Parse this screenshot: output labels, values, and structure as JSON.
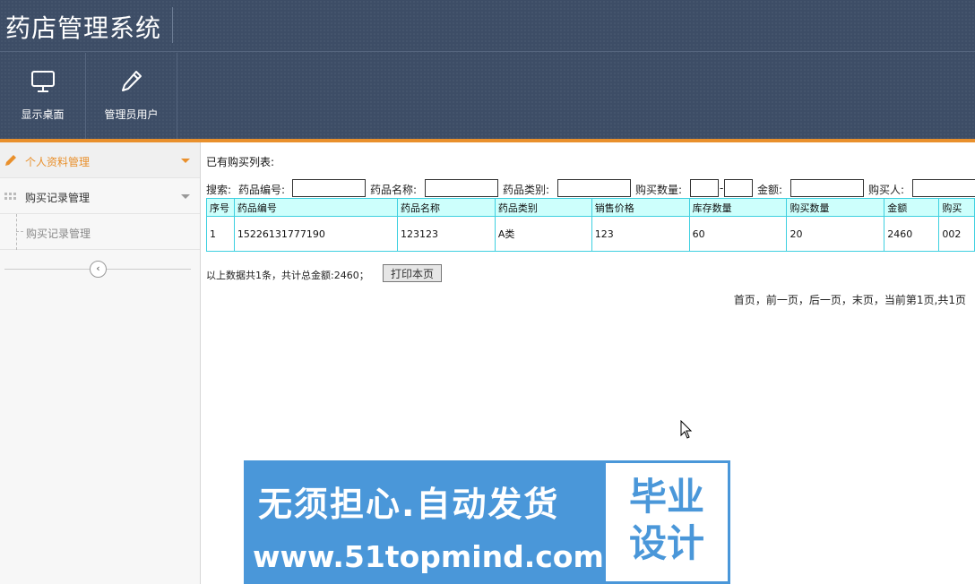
{
  "header": {
    "app_title": "药店管理系统",
    "nav": [
      {
        "label": "显示桌面",
        "icon": "monitor-icon"
      },
      {
        "label": "管理员用户",
        "icon": "pencil-icon"
      }
    ]
  },
  "sidebar": {
    "groups": [
      {
        "label": "个人资料管理",
        "icon": "pencil-icon",
        "active": true
      },
      {
        "label": "购买记录管理",
        "icon": "grid-dots-icon",
        "active": false
      }
    ],
    "sub_items": [
      {
        "label": "购买记录管理"
      }
    ],
    "collapse_icon": "chevron-left-icon"
  },
  "main": {
    "list_title": "已有购买列表:",
    "search": {
      "prefix": "搜索:",
      "drug_code_label": "药品编号:",
      "drug_name_label": "药品名称:",
      "drug_category_label": "药品类别:",
      "quantity_label": "购买数量:",
      "range_sep": "-",
      "amount_label": "金额:",
      "buyer_label": "购买人:",
      "drug_code_value": "",
      "drug_name_value": "",
      "drug_category_value": "",
      "quantity_min_value": "",
      "quantity_max_value": "",
      "amount_value": "",
      "buyer_value": ""
    },
    "table": {
      "headers": [
        "序号",
        "药品编号",
        "药品名称",
        "药品类别",
        "销售价格",
        "库存数量",
        "购买数量",
        "金额",
        "购买"
      ],
      "rows": [
        [
          "1",
          "15226131777190",
          "123123",
          "A类",
          "123",
          "60",
          "20",
          "2460",
          "002"
        ]
      ]
    },
    "summary_text": "以上数据共1条，共计总金额:2460；",
    "print_button": "打印本页",
    "pager": {
      "first": "首页",
      "sep1": "，",
      "prev": "前一页",
      "sep2": "，",
      "next": "后一页",
      "sep3": "，",
      "last": "末页",
      "status": "，当前第1页,共1页"
    }
  },
  "ad": {
    "slogan": "无须担心.自动发货",
    "url": "www.51topmind.com",
    "box_line1": "毕业",
    "box_line2": "设计"
  },
  "colors": {
    "header_bg": "#3d4d66",
    "accent": "#e9902c",
    "table_border": "#3ed0e0",
    "table_header_bg": "#cdfffc",
    "ad_blue": "#4a97d9"
  }
}
